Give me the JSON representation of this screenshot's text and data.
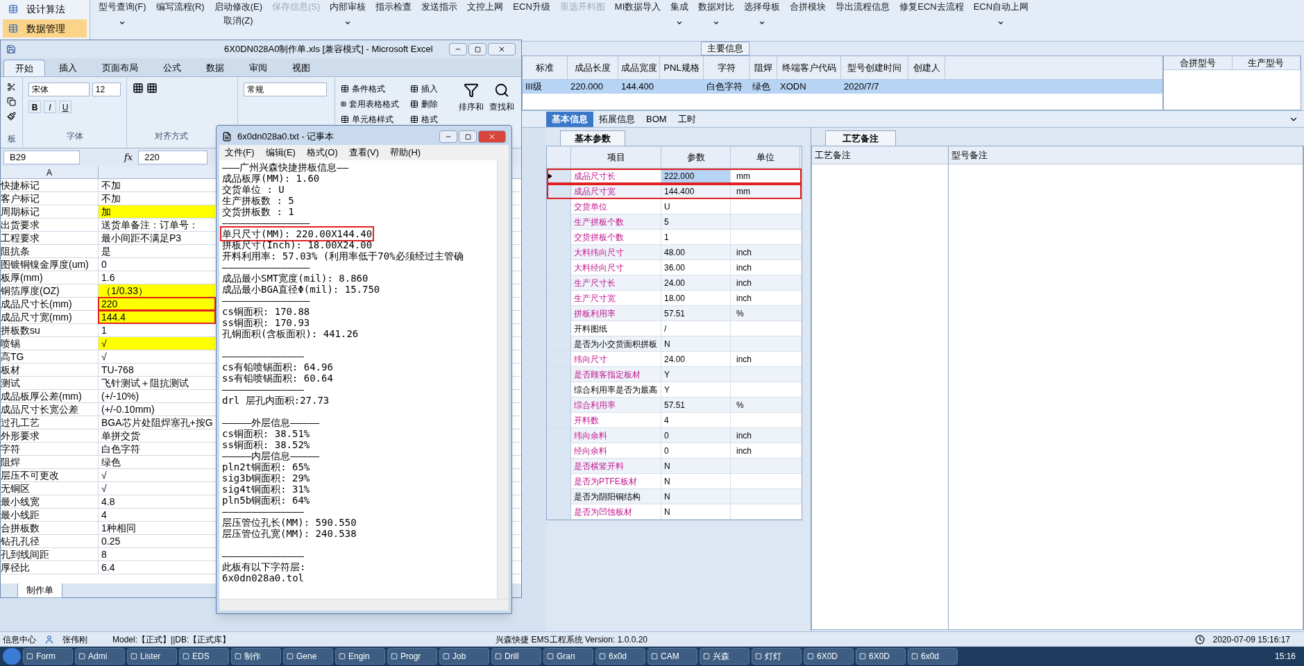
{
  "app": {
    "nav": [
      {
        "label": "设计算法",
        "selected": false
      },
      {
        "label": "数据管理",
        "selected": true
      }
    ],
    "toolbar": [
      {
        "label": "型号查询(F)",
        "disabled": false,
        "dropdown": true
      },
      {
        "label": "编写流程(R)",
        "disabled": false,
        "dropdown": false
      },
      {
        "label": "启动修改(E)",
        "sublabel": "取消(Z)",
        "disabled": false,
        "dropdown": false
      },
      {
        "label": "保存信息(S)",
        "disabled": true,
        "dropdown": false
      },
      {
        "label": "内部审核",
        "disabled": false,
        "dropdown": true
      },
      {
        "label": "指示检查",
        "disabled": false,
        "dropdown": false
      },
      {
        "label": "发送指示",
        "disabled": false,
        "dropdown": false
      },
      {
        "label": "文控上网",
        "disabled": false,
        "dropdown": false
      },
      {
        "label": "ECN升级",
        "disabled": false,
        "dropdown": false
      },
      {
        "label": "重选开料图",
        "disabled": true,
        "dropdown": false
      },
      {
        "label": "MI数据导入",
        "disabled": false,
        "dropdown": false
      },
      {
        "label": "集成",
        "disabled": false,
        "dropdown": true
      },
      {
        "label": "数据对比",
        "disabled": false,
        "dropdown": true
      },
      {
        "label": "选择母板",
        "disabled": false,
        "dropdown": true
      },
      {
        "label": "合拼模块",
        "disabled": false,
        "dropdown": false
      },
      {
        "label": "导出流程信息",
        "disabled": false,
        "dropdown": false
      },
      {
        "label": "修复ECN去流程",
        "disabled": false,
        "dropdown": false
      },
      {
        "label": "ECN自动上网",
        "disabled": false,
        "dropdown": true
      }
    ],
    "main_info": {
      "title": "主要信息",
      "columns": [
        "标准",
        "成品长度",
        "成品宽度",
        "PNL规格",
        "字符",
        "阻焊",
        "终端客户代码",
        "型号创建时间",
        "创建人"
      ],
      "row": {
        "selected": true,
        "cells": [
          "III级",
          "220.000",
          "144.400",
          "",
          "白色字符",
          "绿色",
          "XODN",
          "2020/7/7",
          ""
        ]
      },
      "side_columns": [
        "合拼型号",
        "生产型号"
      ]
    },
    "detail_tabs": [
      {
        "label": "基本信息",
        "selected": true
      },
      {
        "label": "拓展信息",
        "selected": false
      },
      {
        "label": "BOM",
        "selected": false
      },
      {
        "label": "工时",
        "selected": false
      }
    ],
    "params": {
      "tab": "基本参数",
      "columns": [
        "项目",
        "参数",
        "单位"
      ],
      "rows": [
        {
          "name": "成品尺寸长",
          "value": "222.000",
          "unit": "mm",
          "emphasis": true,
          "selected": true,
          "marked": true
        },
        {
          "name": "成品尺寸宽",
          "value": "144.400",
          "unit": "mm",
          "emphasis": true,
          "selected": false,
          "marked": true
        },
        {
          "name": "交货单位",
          "value": "U",
          "unit": "",
          "emphasis": true,
          "selected": false,
          "marked": false
        },
        {
          "name": "生产拼板个数",
          "value": "5",
          "unit": "",
          "emphasis": true,
          "selected": false,
          "marked": false
        },
        {
          "name": "交货拼板个数",
          "value": "1",
          "unit": "",
          "emphasis": true,
          "selected": false,
          "marked": false
        },
        {
          "name": "大料纬向尺寸",
          "value": "48.00",
          "unit": "inch",
          "emphasis": true,
          "selected": false,
          "marked": false
        },
        {
          "name": "大料经向尺寸",
          "value": "36.00",
          "unit": "inch",
          "emphasis": true,
          "selected": false,
          "marked": false
        },
        {
          "name": "生产尺寸长",
          "value": "24.00",
          "unit": "inch",
          "emphasis": true,
          "selected": false,
          "marked": false
        },
        {
          "name": "生产尺寸宽",
          "value": "18.00",
          "unit": "inch",
          "emphasis": true,
          "selected": false,
          "marked": false
        },
        {
          "name": "拼板利用率",
          "value": "57.51",
          "unit": "%",
          "emphasis": true,
          "selected": false,
          "marked": false
        },
        {
          "name": "开料图纸",
          "value": "/",
          "unit": "",
          "emphasis": false,
          "selected": false,
          "marked": false
        },
        {
          "name": "是否为小交货面积拼板",
          "value": "N",
          "unit": "",
          "emphasis": false,
          "selected": false,
          "marked": false
        },
        {
          "name": "纬向尺寸",
          "value": "24.00",
          "unit": "inch",
          "emphasis": true,
          "selected": false,
          "marked": false
        },
        {
          "name": "是否顾客指定板材",
          "value": "Y",
          "unit": "",
          "emphasis": true,
          "selected": false,
          "marked": false
        },
        {
          "name": "综合利用率是否为最高",
          "value": "Y",
          "unit": "",
          "emphasis": false,
          "selected": false,
          "marked": false
        },
        {
          "name": "综合利用率",
          "value": "57.51",
          "unit": "%",
          "emphasis": true,
          "selected": false,
          "marked": false
        },
        {
          "name": "开料数",
          "value": "4",
          "unit": "",
          "emphasis": true,
          "selected": false,
          "marked": false
        },
        {
          "name": "纬向余料",
          "value": "0",
          "unit": "inch",
          "emphasis": true,
          "selected": false,
          "marked": false
        },
        {
          "name": "经向余料",
          "value": "0",
          "unit": "inch",
          "emphasis": true,
          "selected": false,
          "marked": false
        },
        {
          "name": "是否横竖开料",
          "value": "N",
          "unit": "",
          "emphasis": true,
          "selected": false,
          "marked": false
        },
        {
          "name": "是否为PTFE板材",
          "value": "N",
          "unit": "",
          "emphasis": true,
          "selected": false,
          "marked": false
        },
        {
          "name": "是否为阴阳铜结构",
          "value": "N",
          "unit": "",
          "emphasis": false,
          "selected": false,
          "marked": false
        },
        {
          "name": "是否为凹蚀板材",
          "value": "N",
          "unit": "",
          "emphasis": true,
          "selected": false,
          "marked": false
        }
      ]
    },
    "remarks": {
      "tab": "工艺备注",
      "columns": [
        "工艺备注",
        "型号备注"
      ]
    },
    "status_bar": {
      "section": "信息中心",
      "user": "张伟刚",
      "db": "Model:【正式】||DB:【正式库】",
      "system": "兴森快捷 EMS工程系统 Version: 1.0.0.20",
      "datetime": "2020-07-09 15:16:17"
    }
  },
  "excel": {
    "title": "6X0DN028A0制作单.xls  [兼容模式] - Microsoft Excel",
    "tabs": [
      {
        "label": "开始",
        "selected": true
      },
      {
        "label": "插入",
        "selected": false
      },
      {
        "label": "页面布局",
        "selected": false
      },
      {
        "label": "公式",
        "selected": false
      },
      {
        "label": "数据",
        "selected": false
      },
      {
        "label": "审阅",
        "selected": false
      },
      {
        "label": "视图",
        "selected": false
      }
    ],
    "font": "宋体",
    "font_size": "12",
    "font_buttons": [
      "B",
      "I",
      "U"
    ],
    "number_format": "常规",
    "groups": [
      "板",
      "字体",
      "对齐方式"
    ],
    "styles": [
      "条件格式",
      "套用表格格式",
      "单元格样式"
    ],
    "cells": [
      "插入",
      "删除",
      "格式"
    ],
    "editing": [
      "排序和",
      "查找和"
    ],
    "name_box": "B29",
    "formula_label": "fx",
    "formula": "220",
    "column_header": "A",
    "rows": [
      {
        "label": "快捷标记",
        "value": "不加",
        "yellow": false,
        "marked": false
      },
      {
        "label": "客户标记",
        "value": "不加",
        "yellow": false,
        "marked": false
      },
      {
        "label": "周期标记",
        "value": "加",
        "yellow": true,
        "marked": false
      },
      {
        "label": "出货要求",
        "value": "送货单备注：订单号：",
        "yellow": false,
        "marked": false
      },
      {
        "label": "工程要求",
        "value": "最小间距不满足P3",
        "yellow": false,
        "marked": false
      },
      {
        "label": "阻抗条",
        "value": "是",
        "yellow": false,
        "marked": false
      },
      {
        "label": "图镀铜镍金厚度(um)",
        "value": "0",
        "yellow": false,
        "marked": false
      },
      {
        "label": "板厚(mm)",
        "value": "1.6",
        "yellow": false,
        "marked": false
      },
      {
        "label": "铜箔厚度(OZ)",
        "value": "（1/0.33）",
        "yellow": true,
        "marked": false
      },
      {
        "label": "成品尺寸长(mm)",
        "value": "220",
        "yellow": true,
        "marked": true
      },
      {
        "label": "成品尺寸宽(mm)",
        "value": "144.4",
        "yellow": true,
        "marked": true
      },
      {
        "label": "拼板数su",
        "value": "1",
        "yellow": false,
        "marked": false
      },
      {
        "label": "喷锡",
        "value": "√",
        "yellow": true,
        "marked": false
      },
      {
        "label": "高TG",
        "value": "√",
        "yellow": false,
        "marked": false
      },
      {
        "label": "板材",
        "value": "TU-768",
        "yellow": false,
        "marked": false
      },
      {
        "label": "测试",
        "value": "飞针测试＋阻抗测试",
        "yellow": false,
        "marked": false
      },
      {
        "label": "成品板厚公差(mm)",
        "value": "(+/-10%)",
        "yellow": false,
        "marked": false
      },
      {
        "label": "成品尺寸长宽公差",
        "value": "(+/-0.10mm)",
        "yellow": false,
        "marked": false
      },
      {
        "label": "过孔工艺",
        "value": "BGA芯片处阻焊塞孔+按G",
        "yellow": false,
        "marked": false
      },
      {
        "label": "外形要求",
        "value": "单拼交货",
        "yellow": false,
        "marked": false
      },
      {
        "label": "字符",
        "value": "白色字符",
        "yellow": false,
        "marked": false
      },
      {
        "label": "阻焊",
        "value": "绿色",
        "yellow": false,
        "marked": false
      },
      {
        "label": "层压不可更改",
        "value": "√",
        "yellow": false,
        "marked": false
      },
      {
        "label": "无铜区",
        "value": "√",
        "yellow": false,
        "marked": false
      },
      {
        "label": "最小线宽",
        "value": "4.8",
        "yellow": false,
        "marked": false
      },
      {
        "label": "最小线距",
        "value": "4",
        "yellow": false,
        "marked": false
      },
      {
        "label": "合拼板数",
        "value": "1种相同",
        "yellow": false,
        "marked": false
      },
      {
        "label": "钻孔孔径",
        "value": "0.25",
        "yellow": false,
        "marked": false
      },
      {
        "label": "孔到线间距",
        "value": "8",
        "yellow": false,
        "marked": false
      },
      {
        "label": "厚径比",
        "value": "6.4",
        "yellow": false,
        "marked": false
      }
    ],
    "sheet_tab": "制作单"
  },
  "notepad": {
    "title": "6x0dn028a0.txt - 记事本",
    "menus": [
      "文件(F)",
      "编辑(E)",
      "格式(O)",
      "查看(V)",
      "帮助(H)"
    ],
    "lines": [
      {
        "kind": "text",
        "text": "———广州兴森快捷拼板信息——",
        "marked": false
      },
      {
        "kind": "text",
        "text": "成品板厚(MM): 1.60",
        "marked": false
      },
      {
        "kind": "text",
        "text": "交货单位 : U",
        "marked": false
      },
      {
        "kind": "text",
        "text": "生产拼板数 : 5",
        "marked": false
      },
      {
        "kind": "text",
        "text": "交货拼板数 : 1",
        "marked": false
      },
      {
        "kind": "text",
        "text": "———————————————",
        "marked": false
      },
      {
        "kind": "text",
        "text": "单只尺寸(MM): 220.00X144.40",
        "marked": true
      },
      {
        "kind": "text",
        "text": "拼板尺寸(Inch): 18.00X24.00",
        "marked": false
      },
      {
        "kind": "text",
        "text": "开料利用率: 57.03% (利用率低于70%必须经过主管确",
        "marked": false
      },
      {
        "kind": "text",
        "text": "———————————————",
        "marked": false
      },
      {
        "kind": "text",
        "text": "成品最小SMT宽度(mil): 8.860",
        "marked": false
      },
      {
        "kind": "text",
        "text": "成品最小BGA直径Φ(mil):  15.750",
        "marked": false
      },
      {
        "kind": "text",
        "text": "———————————————",
        "marked": false
      },
      {
        "kind": "text",
        "text": "cs铜面积: 170.88",
        "marked": false
      },
      {
        "kind": "text",
        "text": "ss铜面积: 170.93",
        "marked": false
      },
      {
        "kind": "text",
        "text": "孔铜面积(含板面积): 441.26",
        "marked": false
      },
      {
        "kind": "blank"
      },
      {
        "kind": "text",
        "text": "——————————————",
        "marked": false
      },
      {
        "kind": "text",
        "text": "cs有铅喷锡面积: 64.96",
        "marked": false
      },
      {
        "kind": "text",
        "text": "ss有铅喷锡面积: 60.64",
        "marked": false
      },
      {
        "kind": "text",
        "text": "——————————————",
        "marked": false
      },
      {
        "kind": "text",
        "text": "drl          层孔内面积:27.73",
        "marked": false
      },
      {
        "kind": "blank"
      },
      {
        "kind": "text",
        "text": "—————外层信息—————",
        "marked": false
      },
      {
        "kind": "text",
        "text": "cs铜面积: 38.51%",
        "marked": false
      },
      {
        "kind": "text",
        "text": "ss铜面积: 38.52%",
        "marked": false
      },
      {
        "kind": "text",
        "text": "—————内层信息—————",
        "marked": false
      },
      {
        "kind": "text",
        "text": "pln2t铜面积: 65%",
        "marked": false
      },
      {
        "kind": "text",
        "text": "sig3b铜面积: 29%",
        "marked": false
      },
      {
        "kind": "text",
        "text": "sig4t铜面积: 31%",
        "marked": false
      },
      {
        "kind": "text",
        "text": "pln5b铜面积: 64%",
        "marked": false
      },
      {
        "kind": "text",
        "text": "——————————————",
        "marked": false
      },
      {
        "kind": "text",
        "text": "层压管位孔长(MM): 590.550",
        "marked": false
      },
      {
        "kind": "text",
        "text": "层压管位孔宽(MM): 240.538",
        "marked": false
      },
      {
        "kind": "blank"
      },
      {
        "kind": "text",
        "text": "——————————————",
        "marked": false
      },
      {
        "kind": "text",
        "text": "此板有以下字符层:",
        "marked": false
      },
      {
        "kind": "text",
        "text": "6x0dn028a0.tol",
        "marked": false
      }
    ]
  },
  "taskbar": {
    "items": [
      "Form",
      "Admi",
      "Lister",
      "EDS",
      "制作",
      "Gene",
      "Engin",
      "Progr",
      "Job",
      "Drill",
      "Gran",
      "6x0d",
      "CAM",
      "兴森",
      "灯灯",
      "6X0D",
      "6X0D",
      "6x0d"
    ],
    "clock": "15:16"
  }
}
